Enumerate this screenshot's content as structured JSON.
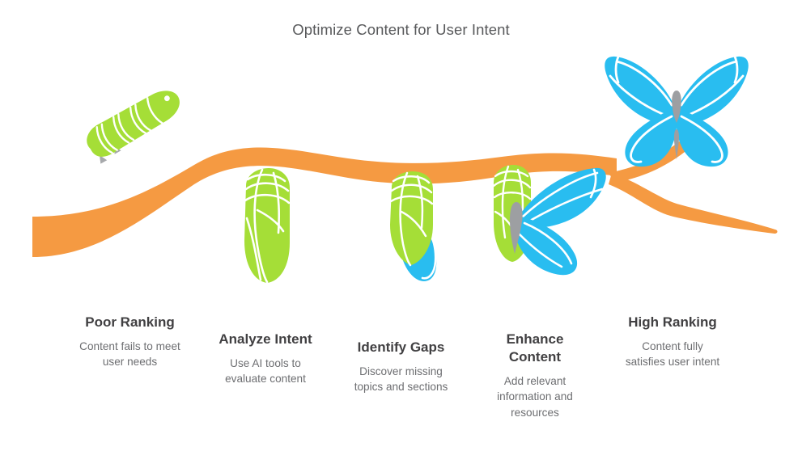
{
  "title": "Optimize Content for User Intent",
  "colors": {
    "orange": "#F59A42",
    "green": "#A5DE37",
    "blue": "#29BDF0",
    "grey": "#9D9FA2",
    "title_text": "#58595b",
    "heading_text": "#414042",
    "body_text": "#6d6e71",
    "background": "#ffffff"
  },
  "stages": [
    {
      "title": "Poor Ranking",
      "description": "Content fails to meet\nuser needs",
      "illustration": "caterpillar-icon"
    },
    {
      "title": "Analyze Intent",
      "description": "Use AI tools to\nevaluate content",
      "illustration": "chrysalis-green-icon"
    },
    {
      "title": "Identify Gaps",
      "description": "Discover missing\ntopics and sections",
      "illustration": "chrysalis-cracking-icon"
    },
    {
      "title": "Enhance\nContent",
      "description": "Add relevant\ninformation and\nresources",
      "illustration": "butterfly-emerging-icon"
    },
    {
      "title": "High Ranking",
      "description": "Content fully\nsatisfies user intent",
      "illustration": "butterfly-full-icon"
    }
  ]
}
